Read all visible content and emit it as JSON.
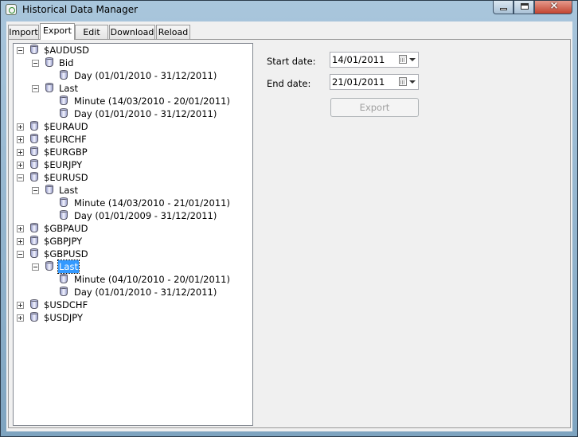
{
  "window": {
    "title": "Historical Data Manager",
    "close_label": "×"
  },
  "tabs": [
    {
      "label": "Import",
      "active": false
    },
    {
      "label": "Export",
      "active": true
    },
    {
      "label": "Edit",
      "active": false
    },
    {
      "label": "Download",
      "active": false
    },
    {
      "label": "Reload",
      "active": false
    }
  ],
  "tree": [
    {
      "label": "$AUDUSD",
      "level": 0,
      "expanded": true
    },
    {
      "label": "Bid",
      "level": 1,
      "expanded": true
    },
    {
      "label": "Day (01/01/2010 - 31/12/2011)",
      "level": 2
    },
    {
      "label": "Last",
      "level": 1,
      "expanded": true
    },
    {
      "label": "Minute (14/03/2010 - 20/01/2011)",
      "level": 2
    },
    {
      "label": "Day (01/01/2010 - 31/12/2011)",
      "level": 2
    },
    {
      "label": "$EURAUD",
      "level": 0,
      "expanded": false
    },
    {
      "label": "$EURCHF",
      "level": 0,
      "expanded": false
    },
    {
      "label": "$EURGBP",
      "level": 0,
      "expanded": false
    },
    {
      "label": "$EURJPY",
      "level": 0,
      "expanded": false
    },
    {
      "label": "$EURUSD",
      "level": 0,
      "expanded": true
    },
    {
      "label": "Last",
      "level": 1,
      "expanded": true
    },
    {
      "label": "Minute (14/03/2010 - 21/01/2011)",
      "level": 2
    },
    {
      "label": "Day (01/01/2009 - 31/12/2011)",
      "level": 2
    },
    {
      "label": "$GBPAUD",
      "level": 0,
      "expanded": false
    },
    {
      "label": "$GBPJPY",
      "level": 0,
      "expanded": false
    },
    {
      "label": "$GBPUSD",
      "level": 0,
      "expanded": true
    },
    {
      "label": "Last",
      "level": 1,
      "expanded": true,
      "selected": true
    },
    {
      "label": "Minute (04/10/2010 - 20/01/2011)",
      "level": 2
    },
    {
      "label": "Day (01/01/2010 - 31/12/2011)",
      "level": 2
    },
    {
      "label": "$USDCHF",
      "level": 0,
      "expanded": false
    },
    {
      "label": "$USDJPY",
      "level": 0,
      "expanded": false
    }
  ],
  "form": {
    "start_label": "Start date:",
    "start_value": "14/01/2011",
    "end_label": "End date:",
    "end_value": "21/01/2011",
    "export_label": "Export",
    "export_enabled": false
  }
}
